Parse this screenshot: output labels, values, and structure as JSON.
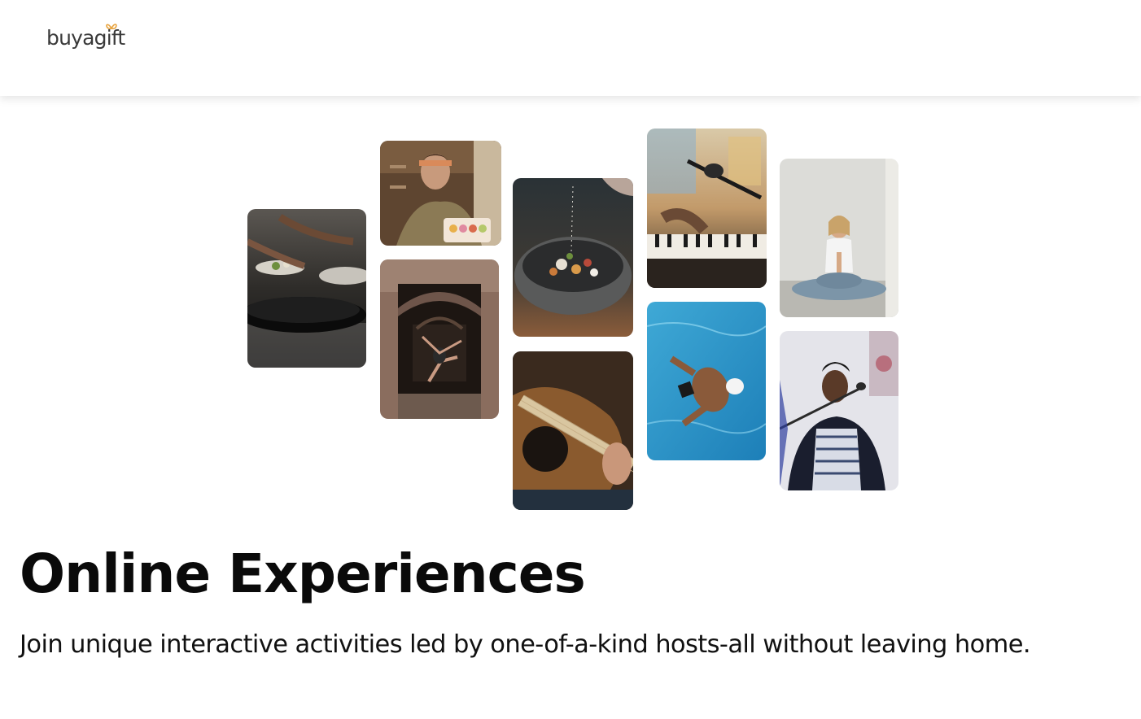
{
  "header": {
    "logo_text": "buyagift",
    "logo_accent_color": "#e8a33d"
  },
  "hero": {
    "title": "Online Experiences",
    "subtitle": "Join unique interactive activities led by one-of-a-kind hosts-all without leaving home."
  },
  "gallery": {
    "photos": [
      {
        "name": "photo-cooking-pans",
        "subject": "cooking"
      },
      {
        "name": "photo-macaron-baker",
        "subject": "baking"
      },
      {
        "name": "photo-dancer-archway",
        "subject": "dance"
      },
      {
        "name": "photo-seasoning-bowl",
        "subject": "cooking"
      },
      {
        "name": "photo-acoustic-guitar",
        "subject": "guitar"
      },
      {
        "name": "photo-piano-microphone",
        "subject": "piano"
      },
      {
        "name": "photo-swimmer-pool",
        "subject": "swimming"
      },
      {
        "name": "photo-yoga-meditation",
        "subject": "yoga"
      },
      {
        "name": "photo-singer-microphone",
        "subject": "singing"
      }
    ]
  }
}
